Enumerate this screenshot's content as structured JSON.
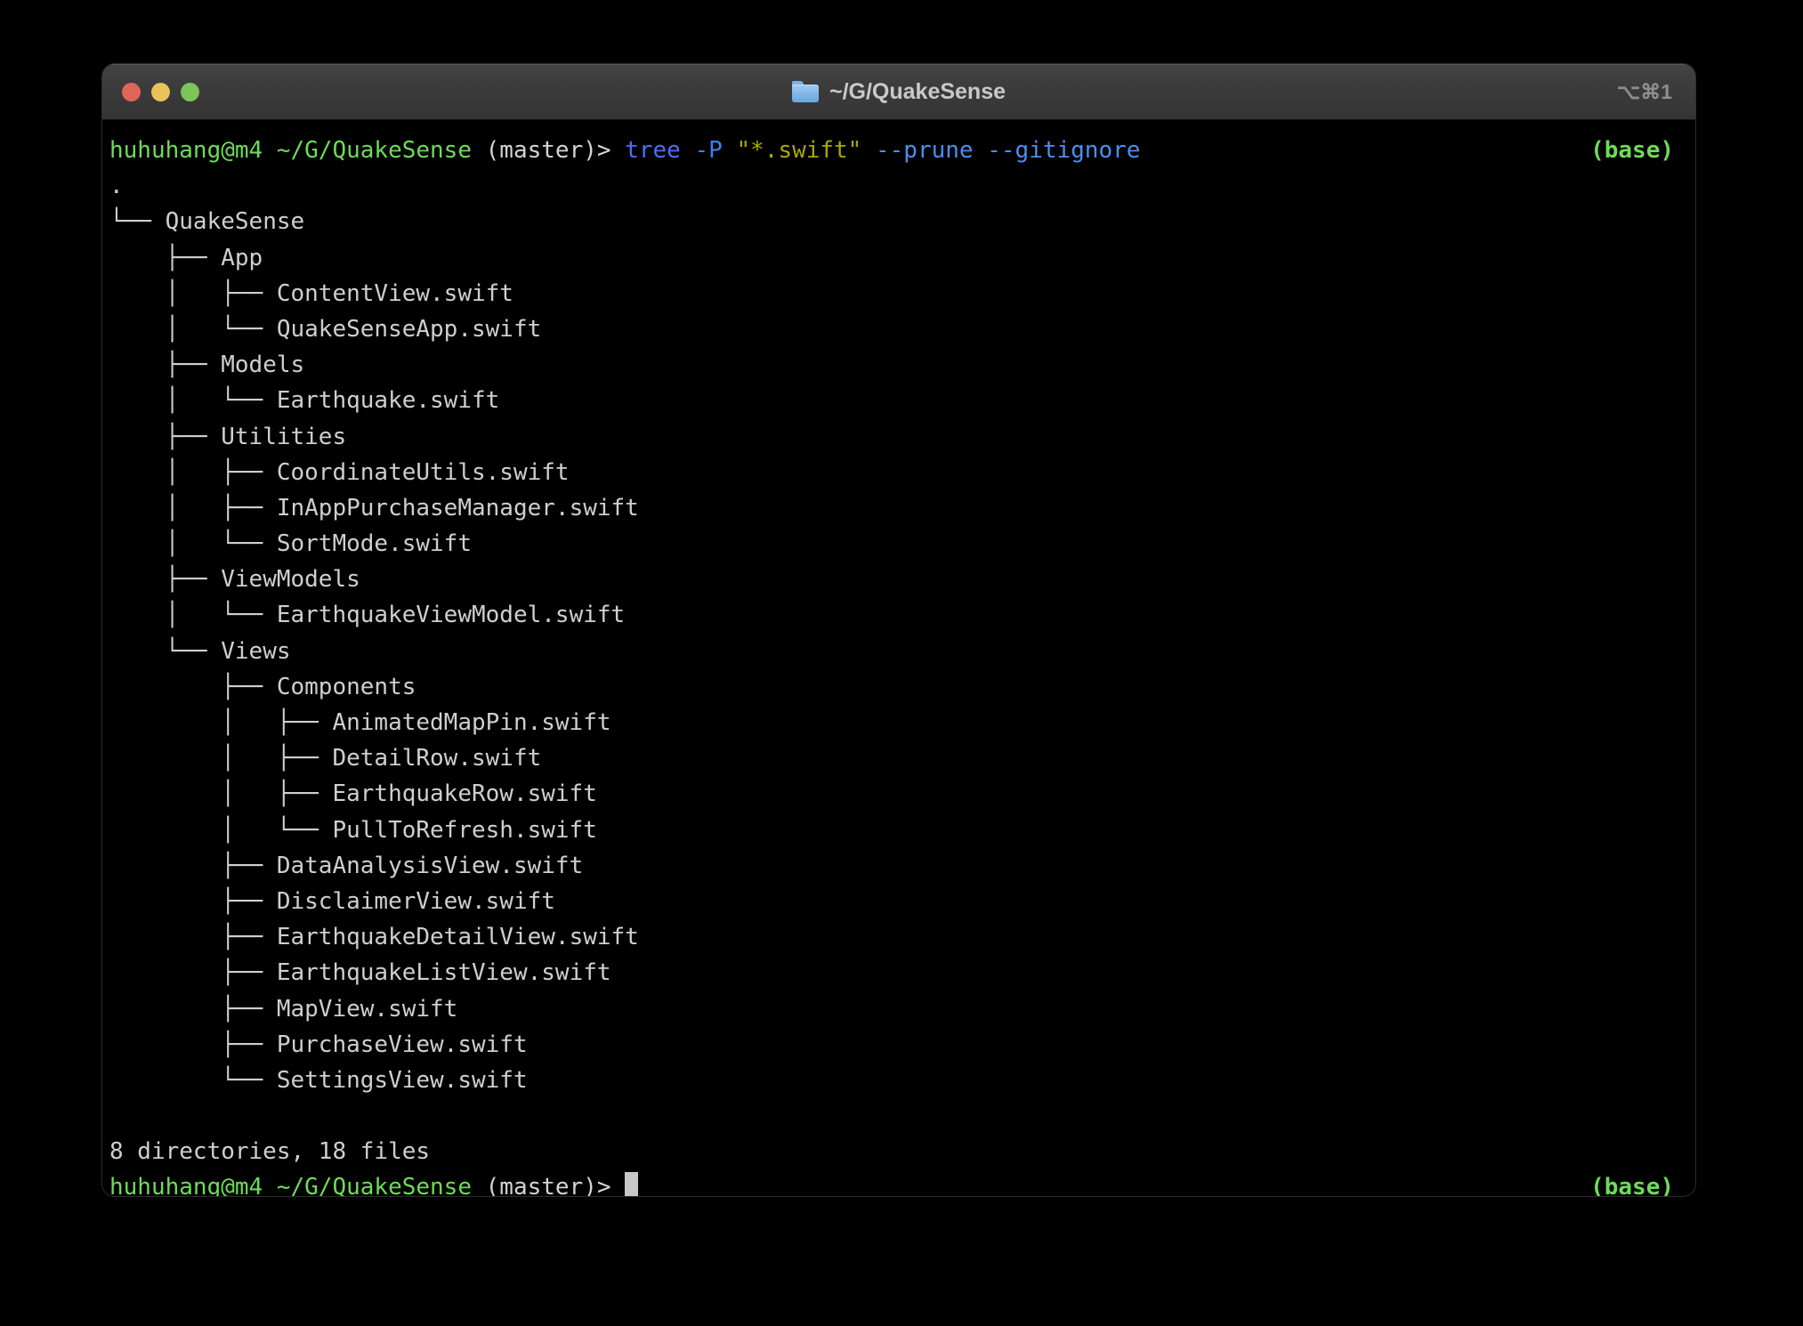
{
  "window": {
    "title": "~/G/QuakeSense",
    "folder_icon": "folder-icon",
    "tab_shortcut": "⌥⌘1",
    "traffic_lights": {
      "close_color": "#e0665a",
      "minimize_color": "#e8c35a",
      "zoom_color": "#7dc45a"
    },
    "titlebar_color": "#3b3b3b",
    "background_color": "#000000"
  },
  "colors": {
    "prompt_green": "#6ddc58",
    "command_blue": "#4c6ef5",
    "string_yellow": "#a8a800",
    "text_gray": "#cfcfcf"
  },
  "session": {
    "prompt": {
      "user_host": "huhuhang@m4",
      "path": "~/G/QuakeSense",
      "git_branch": "(master)>",
      "env_badge": "(base)"
    },
    "command": {
      "name": "tree",
      "flag_pattern": "-P",
      "pattern": "\"*.swift\"",
      "opt_prune": "--prune",
      "opt_gitignore": "--gitignore"
    },
    "tree": {
      "root": ".",
      "lines": [
        {
          "prefix": "└── ",
          "name": "QuakeSense"
        },
        {
          "prefix": "    ├── ",
          "name": "App"
        },
        {
          "prefix": "    │   ├── ",
          "name": "ContentView.swift"
        },
        {
          "prefix": "    │   └── ",
          "name": "QuakeSenseApp.swift"
        },
        {
          "prefix": "    ├── ",
          "name": "Models"
        },
        {
          "prefix": "    │   └── ",
          "name": "Earthquake.swift"
        },
        {
          "prefix": "    ├── ",
          "name": "Utilities"
        },
        {
          "prefix": "    │   ├── ",
          "name": "CoordinateUtils.swift"
        },
        {
          "prefix": "    │   ├── ",
          "name": "InAppPurchaseManager.swift"
        },
        {
          "prefix": "    │   └── ",
          "name": "SortMode.swift"
        },
        {
          "prefix": "    ├── ",
          "name": "ViewModels"
        },
        {
          "prefix": "    │   └── ",
          "name": "EarthquakeViewModel.swift"
        },
        {
          "prefix": "    └── ",
          "name": "Views"
        },
        {
          "prefix": "        ├── ",
          "name": "Components"
        },
        {
          "prefix": "        │   ├── ",
          "name": "AnimatedMapPin.swift"
        },
        {
          "prefix": "        │   ├── ",
          "name": "DetailRow.swift"
        },
        {
          "prefix": "        │   ├── ",
          "name": "EarthquakeRow.swift"
        },
        {
          "prefix": "        │   └── ",
          "name": "PullToRefresh.swift"
        },
        {
          "prefix": "        ├── ",
          "name": "DataAnalysisView.swift"
        },
        {
          "prefix": "        ├── ",
          "name": "DisclaimerView.swift"
        },
        {
          "prefix": "        ├── ",
          "name": "EarthquakeDetailView.swift"
        },
        {
          "prefix": "        ├── ",
          "name": "EarthquakeListView.swift"
        },
        {
          "prefix": "        ├── ",
          "name": "MapView.swift"
        },
        {
          "prefix": "        ├── ",
          "name": "PurchaseView.swift"
        },
        {
          "prefix": "        └── ",
          "name": "SettingsView.swift"
        }
      ]
    },
    "summary": "8 directories, 18 files"
  }
}
